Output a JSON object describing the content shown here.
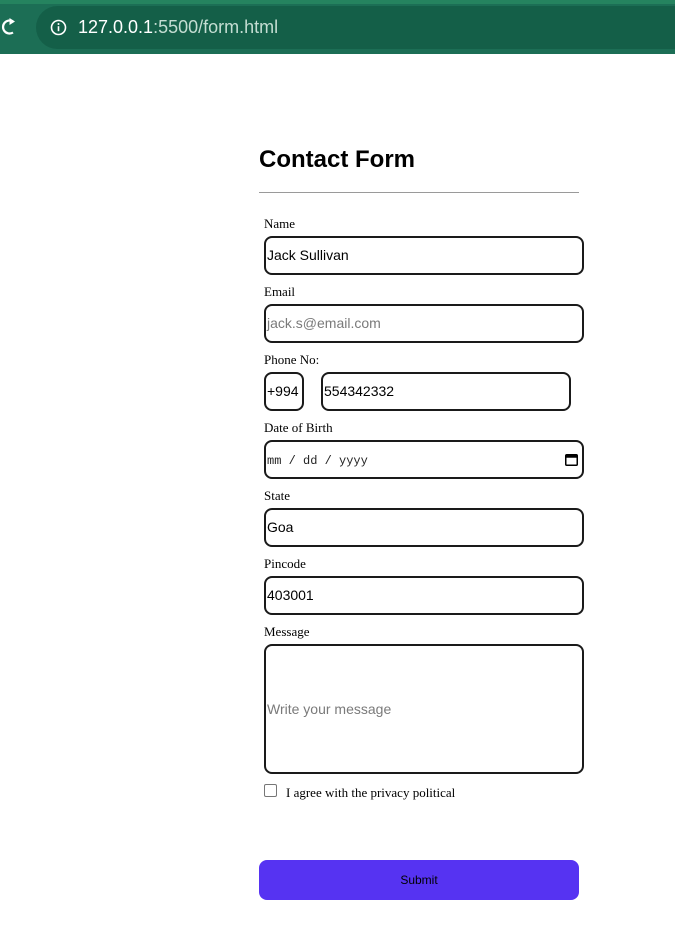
{
  "browser": {
    "url_host": "127.0.0.1",
    "url_rest": ":5500/form.html"
  },
  "form": {
    "title": "Contact Form",
    "fields": {
      "name": {
        "label": "Name",
        "value": "Jack Sullivan"
      },
      "email": {
        "label": "Email",
        "placeholder": "jack.s@email.com"
      },
      "phone": {
        "label": "Phone No:",
        "code": "+994",
        "number": "554342332"
      },
      "dob": {
        "label": "Date of Birth",
        "placeholder": "mm / dd / yyyy"
      },
      "state": {
        "label": "State",
        "value": "Goa"
      },
      "pincode": {
        "label": "Pincode",
        "value": "403001"
      },
      "message": {
        "label": "Message",
        "placeholder": "Write your message"
      }
    },
    "privacy": {
      "label": "I agree with the privacy political",
      "checked": false
    },
    "submit_label": "Submit"
  },
  "colors": {
    "chrome": "#1c6e55",
    "omnibox": "#145f48",
    "submit": "#5633f2"
  },
  "icons": [
    "reload-icon",
    "info-icon",
    "calendar-icon"
  ]
}
